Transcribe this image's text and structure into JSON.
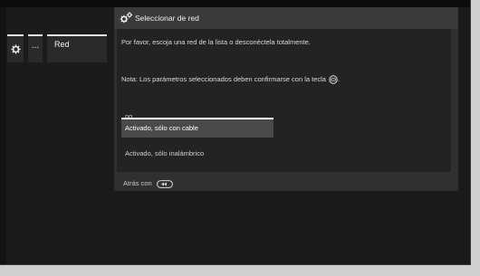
{
  "breadcrumb": {
    "icon": "gear-icon",
    "ellipsis": "...",
    "current": "Red"
  },
  "dialog": {
    "title_icon": "gears-icon",
    "title": "Seleccionar de red",
    "message": "Por favor, escoja una red de la lista o desconéctela totalmente.",
    "note": "Nota: Los parámetros seleccionados deben confirmarse con la tecla",
    "note_key_icon": "ok-key-icon",
    "options": [
      {
        "label": "no",
        "selected": false
      },
      {
        "label": "Activado, sólo con cable",
        "selected": true
      },
      {
        "label": "Activado, sólo inalámbrico",
        "selected": false
      }
    ],
    "footer": "Atrás con",
    "footer_key_icon": "back-key-icon"
  },
  "colors": {
    "background": "#1b1b1b",
    "dialog": "#303030",
    "highlight": "#4a4a4a",
    "text": "#dcdcdc"
  }
}
